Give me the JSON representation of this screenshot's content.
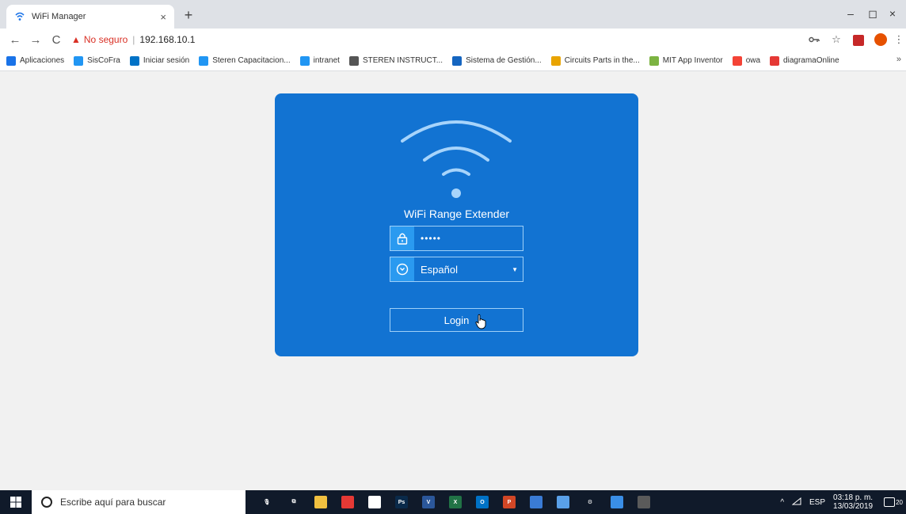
{
  "browser": {
    "tab_title": "WiFi Manager",
    "close_glyph": "×",
    "newtab_glyph": "+",
    "window": {
      "minimize": "–",
      "maximize": "◻",
      "close": "×"
    },
    "nav": {
      "back": "←",
      "forward": "→",
      "reload": "C"
    },
    "address": {
      "security_label": "No seguro",
      "separator": "|",
      "url": "192.168.10.1"
    },
    "toolbar_icons": [
      "key-icon",
      "star-icon",
      "pdf-extension-icon",
      "profile-avatar-icon",
      "menu-icon"
    ]
  },
  "bookmarks": [
    {
      "label": "Aplicaciones",
      "color": "#1a73e8"
    },
    {
      "label": "SisCoFra",
      "color": "#2196f3"
    },
    {
      "label": "Iniciar sesión",
      "color": "#0072c6"
    },
    {
      "label": "Steren Capacitacion...",
      "color": "#2196f3"
    },
    {
      "label": "intranet",
      "color": "#2196f3"
    },
    {
      "label": "STEREN INSTRUCT...",
      "color": "#555555"
    },
    {
      "label": "Sistema de Gestión...",
      "color": "#1565c0"
    },
    {
      "label": "Circuits Parts in the...",
      "color": "#e9a400"
    },
    {
      "label": "MIT App Inventor",
      "color": "#7cb342"
    },
    {
      "label": "owa",
      "color": "#f44336"
    },
    {
      "label": "diagramaOnline",
      "color": "#e53935"
    }
  ],
  "bookmarks_more": "»",
  "login": {
    "title": "WiFi Range Extender",
    "password_mask": "•••••",
    "language": "Español",
    "language_caret": "▼",
    "login_button": "Login",
    "card_color": "#1273d2"
  },
  "taskbar": {
    "search_placeholder": "Escribe aquí para buscar",
    "apps": [
      {
        "name": "microphone-icon",
        "color": "#101a2a",
        "glyph": "🎙"
      },
      {
        "name": "task-view-icon",
        "color": "#101a2a",
        "glyph": "⧉"
      },
      {
        "name": "file-explorer-icon",
        "color": "#f0c040",
        "glyph": ""
      },
      {
        "name": "chrome-icon",
        "color": "#e53935",
        "glyph": ""
      },
      {
        "name": "sticky-notes-icon",
        "color": "#ffffff",
        "glyph": ""
      },
      {
        "name": "photoshop-icon",
        "color": "#0a2a4a",
        "glyph": "Ps"
      },
      {
        "name": "visio-icon",
        "color": "#2b579a",
        "glyph": "V"
      },
      {
        "name": "excel-icon",
        "color": "#217346",
        "glyph": "X"
      },
      {
        "name": "outlook-icon",
        "color": "#0072c6",
        "glyph": "O"
      },
      {
        "name": "powerpoint-icon",
        "color": "#d24726",
        "glyph": "P"
      },
      {
        "name": "snipping-tool-icon",
        "color": "#3a7bd5",
        "glyph": ""
      },
      {
        "name": "notepad-icon",
        "color": "#5aa0e8",
        "glyph": ""
      },
      {
        "name": "settings-icon",
        "color": "#101a2a",
        "glyph": "⚙"
      },
      {
        "name": "remote-desktop-icon",
        "color": "#3a8ee6",
        "glyph": ""
      },
      {
        "name": "calculator-icon",
        "color": "#5a5a5a",
        "glyph": ""
      }
    ],
    "tray_chevron": "^",
    "language": "ESP",
    "time": "03:18 p. m.",
    "date": "13/03/2019",
    "notification_count": "20"
  }
}
